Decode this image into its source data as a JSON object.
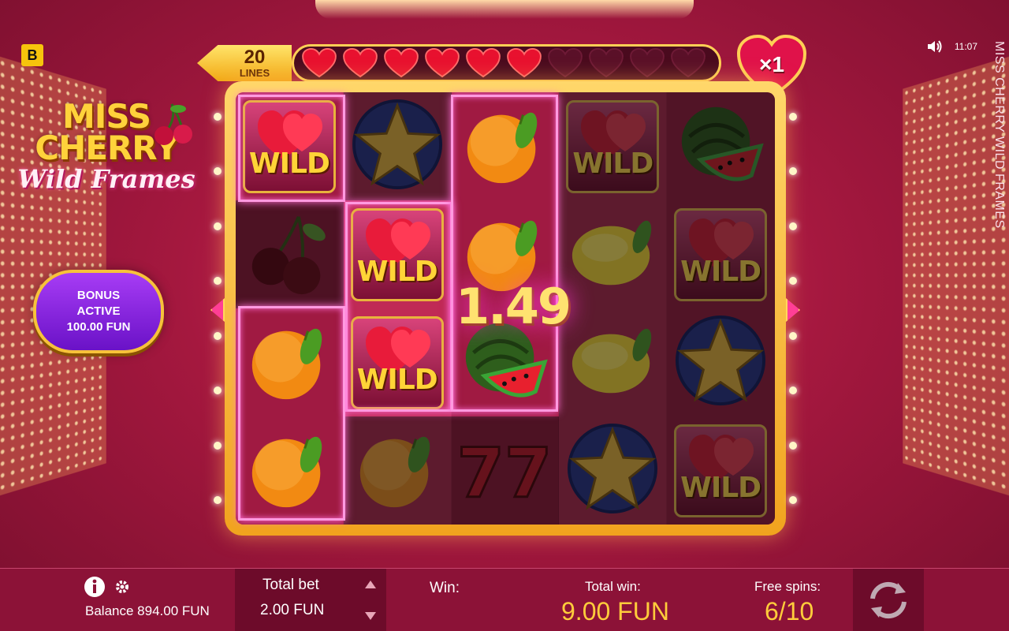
{
  "brand_badge": "B",
  "logo": {
    "line1": "MISS",
    "line2": "CHERRY",
    "line3": "Wild Frames"
  },
  "bonus": {
    "line1": "BONUS",
    "line2": "ACTIVE",
    "line3": "100.00 FUN"
  },
  "game_title_vertical": "MISS CHERRY WILD FRAMES",
  "status": {
    "time": "11:07",
    "speaker_icon": "speaker-icon"
  },
  "lines": {
    "number": "20",
    "label": "LINES"
  },
  "hearts_meter": {
    "filled": 6,
    "total": 10
  },
  "multiplier": "×1",
  "win_amount": "1.49",
  "reels": [
    [
      "wild",
      "cherry",
      "orange",
      "orange"
    ],
    [
      "star",
      "wild",
      "wild",
      "orange"
    ],
    [
      "orange",
      "orange",
      "watermelon",
      "seven"
    ],
    [
      "wild",
      "lemon",
      "lemon",
      "star"
    ],
    [
      "watermelon",
      "wild",
      "star",
      "wild"
    ]
  ],
  "wild_label": "WILD",
  "bottom": {
    "balance_label": "Balance 894.00 FUN",
    "total_bet_label": "Total bet",
    "total_bet_value": "2.00 FUN",
    "win_label": "Win:",
    "total_win_label": "Total win:",
    "total_win_value": "9.00 FUN",
    "free_spins_label": "Free spins:",
    "free_spins_value": "6/10"
  },
  "colors": {
    "accent_gold": "#ffcc3b",
    "frame_gold": "#f1a31e",
    "bonus_purple": "#8a2be2",
    "win_glow": "#ff6fd6"
  }
}
